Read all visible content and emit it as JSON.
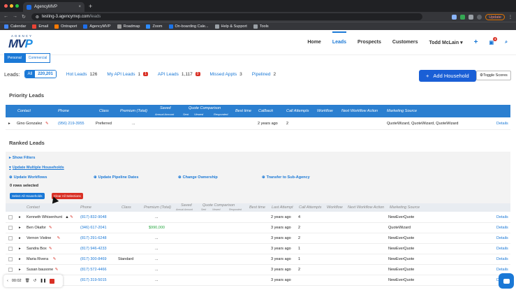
{
  "browser": {
    "tab_title": "AgencyMVP",
    "url_host": "testing-3.agencymvp.com",
    "url_path": "/leads",
    "update_label": "Update",
    "bookmarks": [
      "Calendar",
      "Email",
      "Ontraport",
      "AgencyMVP",
      "Roadmap",
      "Zoom",
      "On-boarding Cale...",
      "Help & Support",
      "Tools"
    ],
    "bookmark_colors": [
      "#4285f4",
      "#ea4335",
      "#ff7a00",
      "#1e6ee8",
      "#999999",
      "#2d8cff",
      "#1a73e8",
      "#9aa0a6",
      "#9aa0a6"
    ]
  },
  "app": {
    "logo_top": "AGENCY",
    "logo_main": "MV",
    "logo_accent": "P",
    "menu": [
      "Home",
      "Leads",
      "Prospects",
      "Customers"
    ],
    "active_menu": "Leads",
    "user_name": "Todd McLain",
    "chat_badge": "4",
    "segment": {
      "personal": "Personal",
      "commercial": "Commercial"
    }
  },
  "leads": {
    "label": "Leads:",
    "all_label": "All",
    "all_count": "220,201",
    "filters": [
      {
        "label": "Hot Leads",
        "count": "126"
      },
      {
        "label": "My API Leads",
        "count": "1",
        "red": "1"
      },
      {
        "label": "API Leads",
        "count": "1,117",
        "red": "0"
      },
      {
        "label": "Missed Appts",
        "count": "3"
      },
      {
        "label": "Pipelined",
        "count": "2"
      }
    ],
    "add_household": "Add Household",
    "toggle_scores": "Toggle Scores"
  },
  "priority": {
    "title": "Priority Leads",
    "headers": [
      "Contact",
      "Phone",
      "Class",
      "Premium (Total)",
      "Saved",
      "Quote Comparison",
      "Best time",
      "Callback",
      "Call Attempts",
      "Workflow",
      "Next Workflow Action",
      "Marketing Source"
    ],
    "sub_saved": "Annual Amount",
    "sub_qc": [
      "Sent",
      "Viewed",
      "Responded"
    ],
    "rows": [
      {
        "contact": "Gino Gonzalez",
        "phone": "(956) 219-3955",
        "class": "Preferred",
        "premium": "...",
        "callback": "2 years ago",
        "attempts": "2",
        "source": "QuoteWizard, QuoteWizard, QuoteWizard",
        "details": "Details"
      }
    ]
  },
  "ranked": {
    "title": "Ranked Leads",
    "show_filters": "Show Filters",
    "update_multiple": "Update Multiple Households",
    "actions": [
      "Update Workflows",
      "Update Pipeline Dates",
      "Change Ownership",
      "Transfer to Sub-Agency"
    ],
    "rows_selected": "0 rows selected",
    "select_all": "Select All Households",
    "clear_all": "Clear All Selections",
    "headers": [
      "Contact",
      "Phone",
      "Class",
      "Premium (Total)",
      "Saved",
      "Quote Comparison",
      "Best time",
      "Last Attempt",
      "Call Attempts",
      "Workflow",
      "Next Workflow Action",
      "Marketing Source"
    ],
    "sub_saved": "Annual Amount",
    "sub_qc": [
      "Sent",
      "Viewed",
      "Responded"
    ],
    "rows": [
      {
        "contact": "Kenneth Whisenhunt",
        "phone": "(817) 832-9048",
        "class": "",
        "premium": "...",
        "last": "2 years ago",
        "attempts": "4",
        "source": "NewEverQuote",
        "details": "Details",
        "warn": true
      },
      {
        "contact": "Ben Okafor",
        "phone": "(346) 617-2041",
        "class": "",
        "premium": "$990,000",
        "last": "3 years ago",
        "attempts": "2",
        "source": "QuoteWizard",
        "details": "Details"
      },
      {
        "contact": "Vernon Vistine",
        "phone": "(817) 291-6248",
        "class": "",
        "premium": "...",
        "last": "3 years ago",
        "attempts": "2",
        "source": "NewEverQuote",
        "details": "Details"
      },
      {
        "contact": "Sandra Box",
        "phone": "(817) 946-4233",
        "class": "",
        "premium": "...",
        "last": "3 years ago",
        "attempts": "1",
        "source": "NewEverQuote",
        "details": "Details"
      },
      {
        "contact": "Maria Rivera",
        "phone": "(817) 300-8469",
        "class": "Standard",
        "premium": "...",
        "last": "3 years ago",
        "attempts": "1",
        "source": "NewEverQuote",
        "details": "Details"
      },
      {
        "contact": "Susan bausone",
        "phone": "(817) 572-4466",
        "class": "",
        "premium": "...",
        "last": "3 years ago",
        "attempts": "2",
        "source": "NewEverQuote",
        "details": "Details"
      },
      {
        "contact": "",
        "phone": "(817) 319-5015",
        "class": "",
        "premium": "...",
        "last": "3 years ago",
        "attempts": "",
        "source": "NewEverQuote",
        "details": "Details"
      }
    ]
  },
  "recorder": {
    "time": "00:02"
  }
}
